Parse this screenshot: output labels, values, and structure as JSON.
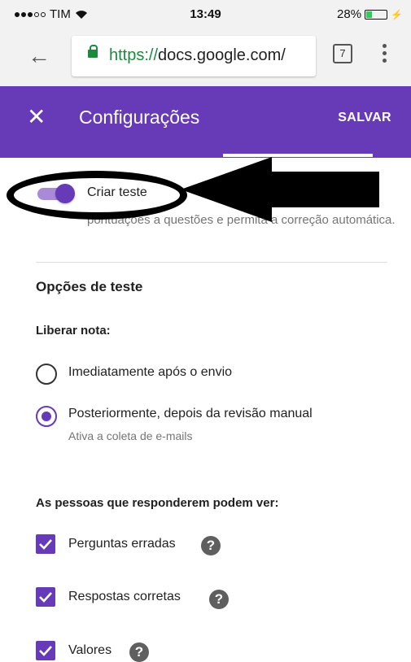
{
  "status_bar": {
    "carrier": "TIM",
    "time": "13:49",
    "battery": "28%",
    "battery_level": 0.28
  },
  "browser": {
    "url_scheme": "https://",
    "url_rest": "docs.google.com/",
    "tab_count": "7"
  },
  "app_bar": {
    "title": "Configurações",
    "save_label": "SALVAR"
  },
  "quiz": {
    "toggle_label": "Criar teste",
    "toggle_on": true,
    "description": "pontuações a questões e permita a correção automática."
  },
  "options": {
    "title": "Opções de teste",
    "release_grade": {
      "label": "Liberar nota:",
      "choices": [
        {
          "label": "Imediatamente após o envio",
          "sublabel": "",
          "selected": false
        },
        {
          "label": "Posteriormente, depois da revisão manual",
          "sublabel": "Ativa a coleta de e-mails",
          "selected": true
        }
      ]
    },
    "respondents_see": {
      "label": "As pessoas que responderem podem ver:",
      "items": [
        {
          "label": "Perguntas erradas",
          "checked": true
        },
        {
          "label": "Respostas corretas",
          "checked": true
        },
        {
          "label": "Valores",
          "checked": true
        }
      ]
    }
  },
  "colors": {
    "accent": "#673ab7",
    "url_green": "#1a8a3c"
  }
}
